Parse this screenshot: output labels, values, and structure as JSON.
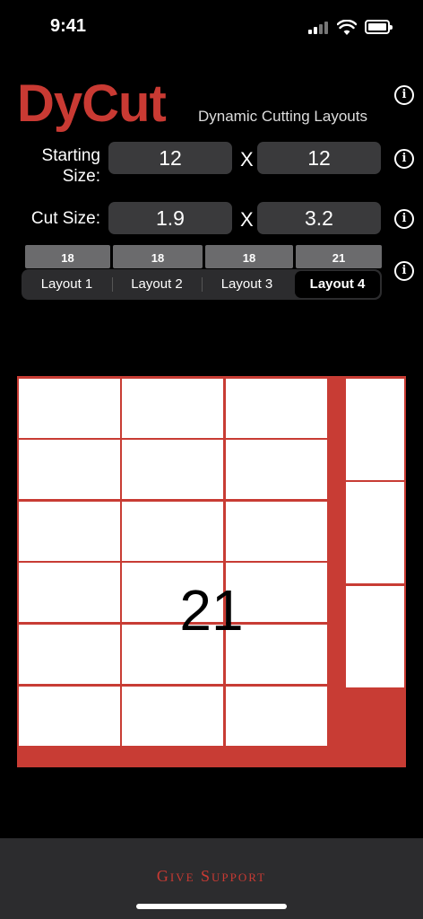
{
  "status": {
    "time": "9:41"
  },
  "header": {
    "logo": "DyCut",
    "subtitle": "Dynamic Cutting Layouts"
  },
  "starting_size": {
    "label_line1": "Starting",
    "label_line2": "Size:",
    "width": "12",
    "height": "12",
    "separator": "X"
  },
  "cut_size": {
    "label": "Cut Size:",
    "width": "1.9",
    "height": "3.2",
    "separator": "X"
  },
  "layouts": [
    {
      "label": "Layout 1",
      "count": "18",
      "selected": false
    },
    {
      "label": "Layout 2",
      "count": "18",
      "selected": false
    },
    {
      "label": "Layout 3",
      "count": "18",
      "selected": false
    },
    {
      "label": "Layout 4",
      "count": "21",
      "selected": true
    }
  ],
  "board": {
    "piece_count": "21",
    "waste_color": "#c83c34",
    "piece_color": "#ffffff"
  },
  "footer": {
    "support_label": "Give Support"
  },
  "icons": {
    "info": "info-circle-icon"
  },
  "colors": {
    "accent": "#c93a33",
    "background": "#000000",
    "field": "#3a3a3c"
  }
}
